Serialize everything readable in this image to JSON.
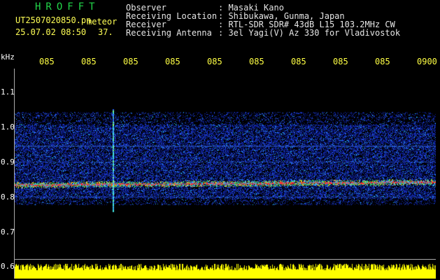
{
  "header": {
    "title": "HROFFT",
    "filename": "UT2507020850.pn",
    "event": "meteor",
    "datetime": "25.07.02 08:50",
    "level": "37."
  },
  "info": {
    "observer_label": "Observer",
    "observer_value": ": Masaki Kano",
    "location_label": "Receiving Location",
    "location_value": ": Shibukawa, Gunma, Japan",
    "receiver_label": "Receiver",
    "receiver_value": ": RTL-SDR SDR# 43dB L15 103.2MHz CW",
    "antenna_label": "Receiving Antenna",
    "antenna_value": ": 3el Yagi(V) Az 330 for Vladivostok"
  },
  "time_axis": {
    "ticks": [
      "085",
      "085",
      "085",
      "085",
      "085",
      "085",
      "085",
      "085",
      "085",
      "0900"
    ]
  },
  "freq_axis": {
    "unit": "kHz",
    "ticks": [
      "1.1",
      "1.0",
      "0.9",
      "0.8",
      "0.7",
      "0.6"
    ]
  },
  "colors": {
    "title": "#22d64a",
    "meta": "#ffff55",
    "tick": "#ffff44",
    "noise": "#1a35c8",
    "carrier": "#ff3030",
    "level_bar": "#ffff00"
  }
}
